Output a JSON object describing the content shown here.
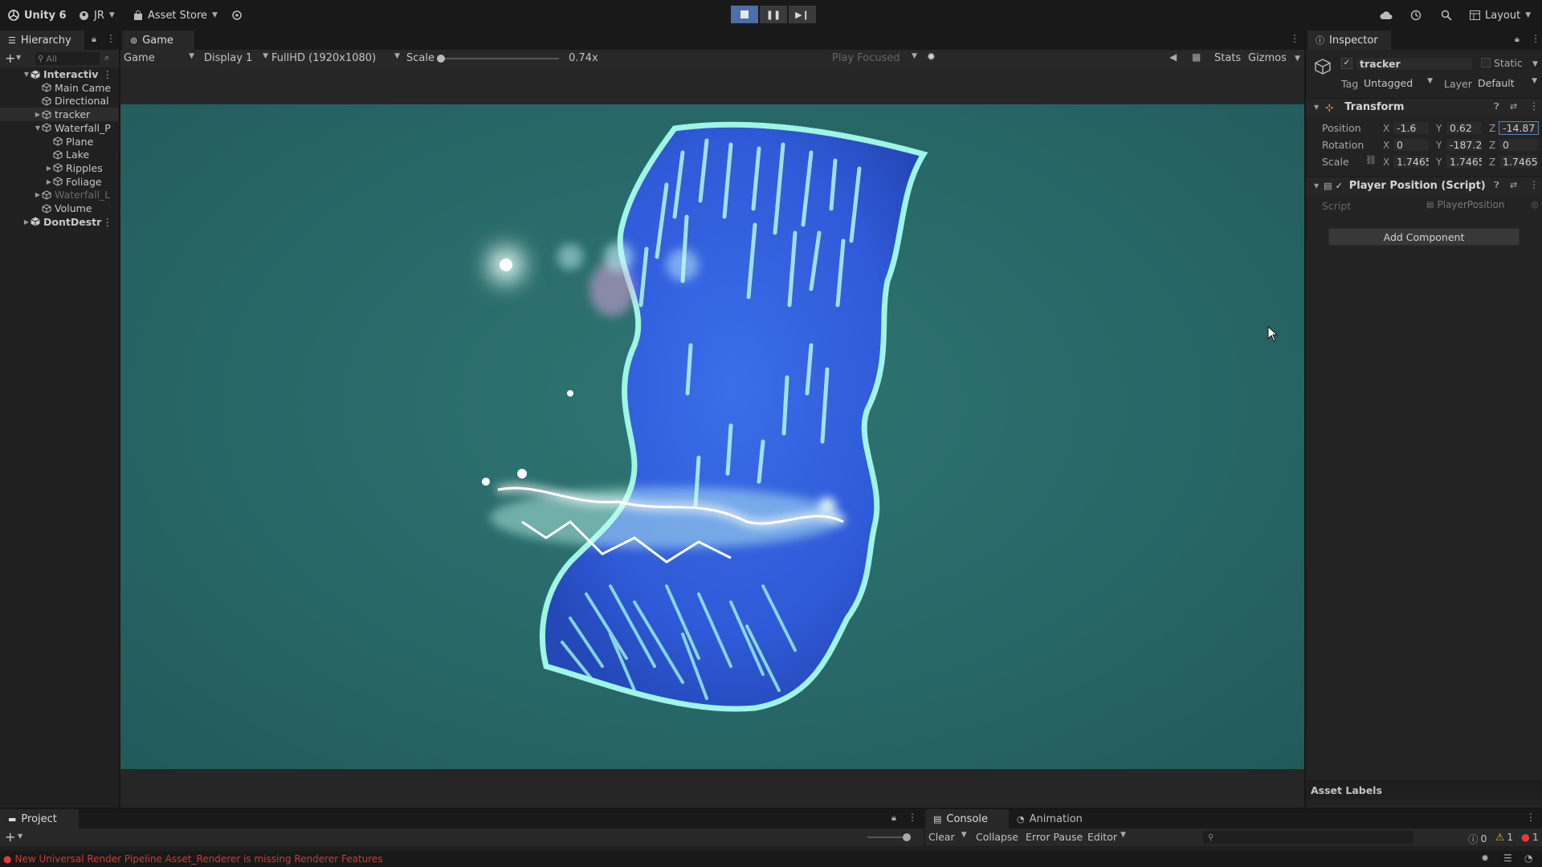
{
  "toolbar": {
    "app_name": "Unity 6",
    "account": "JR",
    "asset_store": "Asset Store",
    "layout": "Layout"
  },
  "hierarchy": {
    "tab": "Hierarchy",
    "search_placeholder": "All",
    "items": [
      {
        "label": "Interactiv",
        "indent": 0,
        "expand": "open",
        "scene": true
      },
      {
        "label": "Main Came",
        "indent": 1,
        "expand": "none"
      },
      {
        "label": "Directional",
        "indent": 1,
        "expand": "none"
      },
      {
        "label": "tracker",
        "indent": 1,
        "expand": "closed",
        "selected": true
      },
      {
        "label": "Waterfall_P",
        "indent": 1,
        "expand": "open"
      },
      {
        "label": "Plane",
        "indent": 2,
        "expand": "none"
      },
      {
        "label": "Lake",
        "indent": 2,
        "expand": "none"
      },
      {
        "label": "Ripples",
        "indent": 2,
        "expand": "closed"
      },
      {
        "label": "Foliage",
        "indent": 2,
        "expand": "closed"
      },
      {
        "label": "Waterfall_L",
        "indent": 1,
        "expand": "closed",
        "dim": true
      },
      {
        "label": "Volume",
        "indent": 1,
        "expand": "none"
      },
      {
        "label": "DontDestr",
        "indent": 0,
        "expand": "closed",
        "scene": true
      }
    ]
  },
  "game": {
    "tab": "Game",
    "mode": "Game",
    "display": "Display 1",
    "resolution": "FullHD (1920x1080)",
    "scale_label": "Scale",
    "scale_value": "0.74x",
    "play_focused": "Play Focused",
    "stats": "Stats",
    "gizmos": "Gizmos"
  },
  "inspector": {
    "tab": "Inspector",
    "object_name": "tracker",
    "static_label": "Static",
    "tag_label": "Tag",
    "tag_value": "Untagged",
    "layer_label": "Layer",
    "layer_value": "Default",
    "transform": {
      "title": "Transform",
      "position_label": "Position",
      "rotation_label": "Rotation",
      "scale_label": "Scale",
      "position": {
        "x": "-1.6",
        "y": "0.62",
        "z": "-14.87"
      },
      "rotation": {
        "x": "0",
        "y": "-187.2",
        "z": "0"
      },
      "scale": {
        "x": "1.7465",
        "y": "1.7465",
        "z": "1.7465"
      }
    },
    "script_component": {
      "title": "Player Position (Script)",
      "script_label": "Script",
      "script_value": "PlayerPosition"
    },
    "add_component": "Add Component",
    "asset_labels": "Asset Labels"
  },
  "bottom": {
    "project_tab": "Project",
    "console_tab": "Console",
    "animation_tab": "Animation",
    "clear": "Clear",
    "collapse": "Collapse",
    "error_pause": "Error Pause",
    "editor": "Editor",
    "info_count": "0",
    "warning_count": "1",
    "error_count": "1"
  },
  "status": {
    "message": "New Universal Render Pipeline Asset_Renderer is missing Renderer Features"
  },
  "colors": {
    "accent": "#4b6fa8",
    "viewport_bg": "#276867",
    "water_deep": "#2f5ad8",
    "water_foam": "#8ef0e0",
    "error": "#e23b3b",
    "warning": "#e8b52a"
  }
}
